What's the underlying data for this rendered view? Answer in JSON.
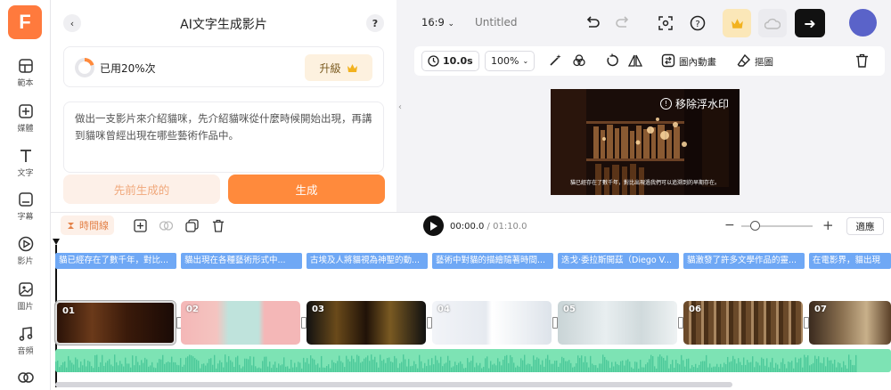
{
  "app": {
    "logo_letter": "F"
  },
  "rail": {
    "items": [
      {
        "label": "範本",
        "icon": "template-icon"
      },
      {
        "label": "媒體",
        "icon": "media-add-icon"
      },
      {
        "label": "文字",
        "icon": "text-icon"
      },
      {
        "label": "字幕",
        "icon": "subtitle-icon"
      },
      {
        "label": "影片",
        "icon": "video-icon"
      },
      {
        "label": "圖片",
        "icon": "image-icon"
      },
      {
        "label": "音頻",
        "icon": "audio-icon"
      },
      {
        "label": "",
        "icon": "elements-icon"
      }
    ]
  },
  "panel": {
    "title": "AI文字生成影片",
    "usage_text": "已用20%次",
    "usage_fraction": 0.2,
    "upgrade_label": "升級",
    "prompt": "做出一支影片來介紹貓咪，先介紹貓咪從什麼時候開始出現，再講到貓咪曾經出現在哪些藝術作品中。",
    "prev_label": "先前生成的",
    "generate_label": "生成"
  },
  "topbar": {
    "ratio": "16:9",
    "doc_title": "Untitled"
  },
  "toolbar": {
    "duration": "10.0s",
    "zoom": "100%",
    "in_anim_label": "圖內動畫",
    "matte_label": "摳圖"
  },
  "preview": {
    "watermark": "移除浮水印",
    "subtitle": "貓已經存在了數千年，對比出現過我們可以追溯到的早期存在。"
  },
  "timeline": {
    "timeline_label": "時間線",
    "current_time": "00:00.0",
    "total_time": "/ 01:10.0",
    "fit_label": "適應",
    "zoom_level": 0.15,
    "subtitles": [
      "貓已經存在了數千年，對比...",
      "貓出現在各種藝術形式中...",
      "古埃及人將貓視為神聖的動...",
      "藝術中對貓的描繪隨著時間...",
      "迭戈·委拉斯開茲（Diego V...",
      "貓激發了許多文學作品的靈...",
      "在電影界，貓出現"
    ],
    "clips": [
      "01",
      "02",
      "03",
      "04",
      "05",
      "06",
      "07"
    ]
  },
  "colors": {
    "accent": "#ff8a3c",
    "subtitle_chip": "#6fa8f5",
    "audio_track": "#7de3b4",
    "avatar": "#5a63c9"
  }
}
